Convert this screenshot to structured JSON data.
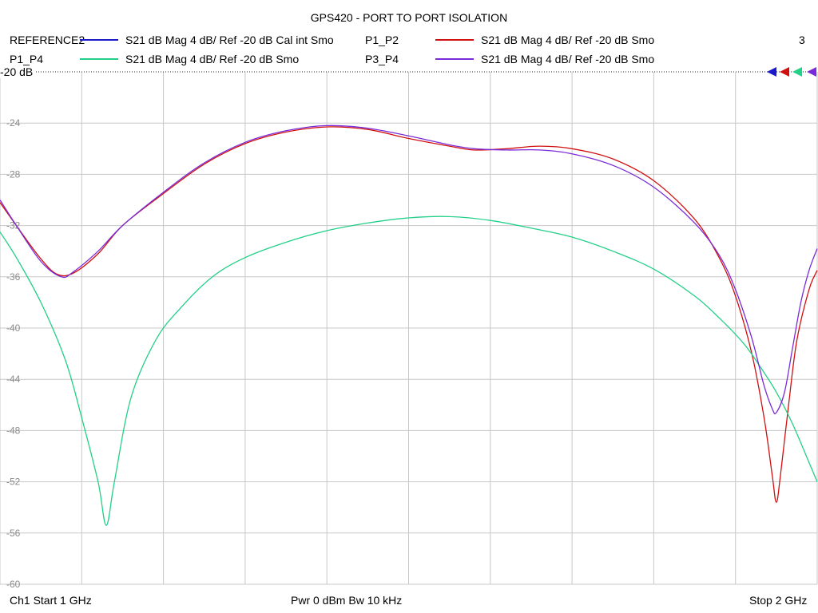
{
  "chart_data": {
    "type": "line",
    "title": "GPS420 - PORT TO PORT ISOLATION",
    "channel_number": "3",
    "reference_label": "-20 dB",
    "x_unit": "GHz",
    "xlim": [
      1.0,
      2.0
    ],
    "ylim": [
      -60,
      -20
    ],
    "y_ticks": [
      -20,
      -24,
      -28,
      -32,
      -36,
      -40,
      -44,
      -48,
      -52,
      -56,
      -60
    ],
    "y_tick_labels": [
      "-20",
      "-24",
      "-28",
      "-32",
      "-36",
      "-40",
      "-44",
      "-48",
      "-52",
      "-56",
      "-60"
    ],
    "x_divisions": 10,
    "grid": true,
    "footer": {
      "left": "Ch1  Start  1 GHz",
      "center": "Pwr  0 dBm  Bw  10 kHz",
      "right": "Stop  2 GHz"
    },
    "series": [
      {
        "name": "REFERENCE2",
        "description": "S21  dB Mag  4 dB/ Ref -20 dB  Cal int Smo",
        "color": "#1a1acc",
        "x": [],
        "y": []
      },
      {
        "name": "P1_P2",
        "description": "S21  dB Mag  4 dB/ Ref -20 dB  Smo",
        "color": "#d01010",
        "x": [
          1.0,
          1.02,
          1.05,
          1.07,
          1.09,
          1.12,
          1.15,
          1.2,
          1.25,
          1.3,
          1.35,
          1.4,
          1.45,
          1.5,
          1.55,
          1.58,
          1.62,
          1.66,
          1.7,
          1.75,
          1.8,
          1.85,
          1.88,
          1.9,
          1.92,
          1.935,
          1.945,
          1.95,
          1.955,
          1.965,
          1.975,
          1.99,
          2.0
        ],
        "y": [
          -30.2,
          -32.0,
          -34.6,
          -35.8,
          -35.7,
          -34.2,
          -32.0,
          -29.5,
          -27.2,
          -25.6,
          -24.7,
          -24.3,
          -24.5,
          -25.2,
          -25.8,
          -26.1,
          -26.0,
          -25.8,
          -26.0,
          -26.8,
          -28.5,
          -31.5,
          -34.5,
          -37.5,
          -42.0,
          -47.0,
          -51.5,
          -53.6,
          -51.5,
          -46.0,
          -41.0,
          -37.0,
          -35.5
        ]
      },
      {
        "name": "P1_P4",
        "description": "S21  dB Mag  4 dB/ Ref -20 dB  Smo",
        "color": "#22d088",
        "x": [
          1.0,
          1.02,
          1.05,
          1.08,
          1.1,
          1.12,
          1.13,
          1.14,
          1.16,
          1.19,
          1.22,
          1.26,
          1.3,
          1.35,
          1.4,
          1.45,
          1.5,
          1.55,
          1.6,
          1.65,
          1.7,
          1.75,
          1.8,
          1.85,
          1.88,
          1.91,
          1.93,
          1.95,
          1.97,
          1.99,
          2.0
        ],
        "y": [
          -32.5,
          -34.5,
          -38.0,
          -42.5,
          -47.0,
          -52.0,
          -55.4,
          -52.0,
          -45.5,
          -41.0,
          -38.5,
          -36.0,
          -34.5,
          -33.3,
          -32.4,
          -31.8,
          -31.4,
          -31.3,
          -31.6,
          -32.2,
          -32.9,
          -34.0,
          -35.4,
          -37.5,
          -39.2,
          -41.2,
          -43.0,
          -45.0,
          -47.5,
          -50.5,
          -52.0
        ]
      },
      {
        "name": "P3_P4",
        "description": "S21  dB Mag  4 dB/ Ref -20 dB  Smo",
        "color": "#7a2ad8",
        "x": [
          1.0,
          1.02,
          1.05,
          1.075,
          1.09,
          1.12,
          1.15,
          1.2,
          1.25,
          1.3,
          1.35,
          1.4,
          1.45,
          1.5,
          1.55,
          1.58,
          1.62,
          1.66,
          1.7,
          1.75,
          1.8,
          1.85,
          1.88,
          1.9,
          1.92,
          1.935,
          1.945,
          1.95,
          1.96,
          1.97,
          1.98,
          1.99,
          2.0
        ],
        "y": [
          -30.0,
          -32.0,
          -34.8,
          -36.0,
          -35.6,
          -34.0,
          -32.0,
          -29.4,
          -27.1,
          -25.5,
          -24.6,
          -24.2,
          -24.4,
          -25.0,
          -25.7,
          -26.0,
          -26.1,
          -26.1,
          -26.4,
          -27.3,
          -29.0,
          -31.8,
          -34.3,
          -37.0,
          -40.8,
          -44.5,
          -46.3,
          -46.6,
          -45.0,
          -41.5,
          -38.0,
          -35.5,
          -33.8
        ]
      }
    ]
  }
}
